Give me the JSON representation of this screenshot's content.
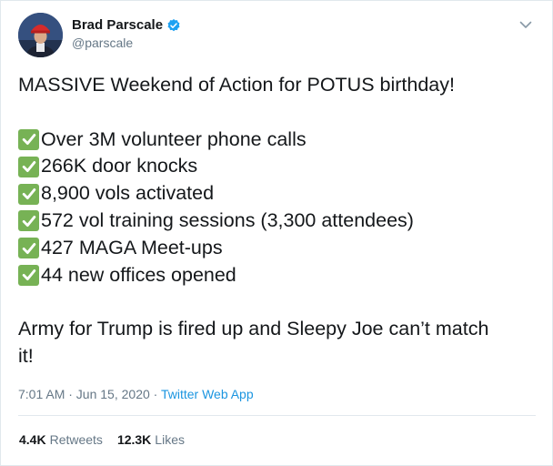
{
  "author": {
    "name": "Brad Parscale",
    "handle": "@parscale"
  },
  "tweet": {
    "lines": [
      {
        "text": "MASSIVE Weekend of Action for POTUS birthday!",
        "check": false
      },
      {
        "text": "",
        "check": false
      },
      {
        "text": "Over 3M volunteer phone calls",
        "check": true
      },
      {
        "text": "266K door knocks",
        "check": true
      },
      {
        "text": "8,900 vols activated",
        "check": true
      },
      {
        "text": "572 vol training sessions (3,300 attendees)",
        "check": true
      },
      {
        "text": "427 MAGA Meet-ups",
        "check": true
      },
      {
        "text": "44 new offices opened",
        "check": true
      },
      {
        "text": "",
        "check": false
      },
      {
        "text": "Army for Trump is fired up and Sleepy Joe can’t match",
        "check": false
      },
      {
        "text": "it!",
        "check": false
      }
    ]
  },
  "meta": {
    "time": "7:01 AM · Jun 15, 2020 · ",
    "source": "Twitter Web App"
  },
  "stats": {
    "retweets_count": "4.4K",
    "retweets_label": "Retweets",
    "likes_count": "12.3K",
    "likes_label": "Likes"
  },
  "icons": {
    "checkmark": "white-heavy-check-mark-icon",
    "verified": "verified-badge-icon",
    "more": "chevron-down-icon"
  },
  "colors": {
    "check_green": "#77b255",
    "link_blue": "#1b95e0",
    "verified_blue": "#1da1f2",
    "muted_gray": "#657786"
  }
}
